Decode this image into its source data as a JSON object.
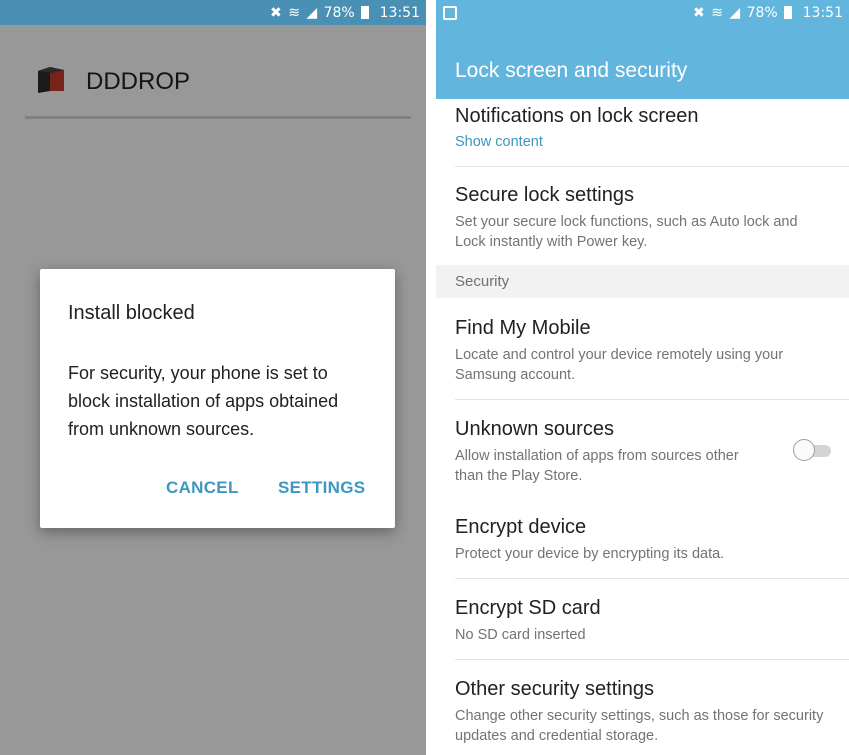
{
  "status_bar": {
    "battery": "78%",
    "time": "13:51"
  },
  "left_screen": {
    "app_name": "DDDROP",
    "dialog": {
      "title": "Install blocked",
      "message": "For security, your phone is set to block installation of apps obtained from unknown sources.",
      "cancel_label": "CANCEL",
      "settings_label": "SETTINGS"
    }
  },
  "right_screen": {
    "toolbar_title": "Lock screen and security",
    "rows": {
      "notifications": {
        "title": "Notifications on lock screen",
        "subtitle": "Show content"
      },
      "secure_lock": {
        "title": "Secure lock settings",
        "subtitle": "Set your secure lock functions, such as Auto lock and Lock instantly with Power key."
      },
      "find_my_mobile": {
        "title": "Find My Mobile",
        "subtitle": "Locate and control your device remotely using your Samsung account."
      },
      "unknown_sources": {
        "title": "Unknown sources",
        "subtitle": "Allow installation of apps from sources other than the Play Store.",
        "enabled": false
      },
      "encrypt_device": {
        "title": "Encrypt device",
        "subtitle": "Protect your device by encrypting its data."
      },
      "encrypt_sd": {
        "title": "Encrypt SD card",
        "subtitle": "No SD card inserted"
      },
      "other_security": {
        "title": "Other security settings",
        "subtitle": "Change other security settings, such as those for security updates and credential storage."
      }
    },
    "section_security": "Security"
  },
  "icons": [
    "mute-icon",
    "wifi-icon",
    "signal-icon",
    "battery-icon",
    "screenshot-icon",
    "app-logo-icon"
  ],
  "colors": {
    "left_status_bar": "#4a90b5",
    "right_header": "#62b6dd",
    "accent": "#3d97c0"
  }
}
